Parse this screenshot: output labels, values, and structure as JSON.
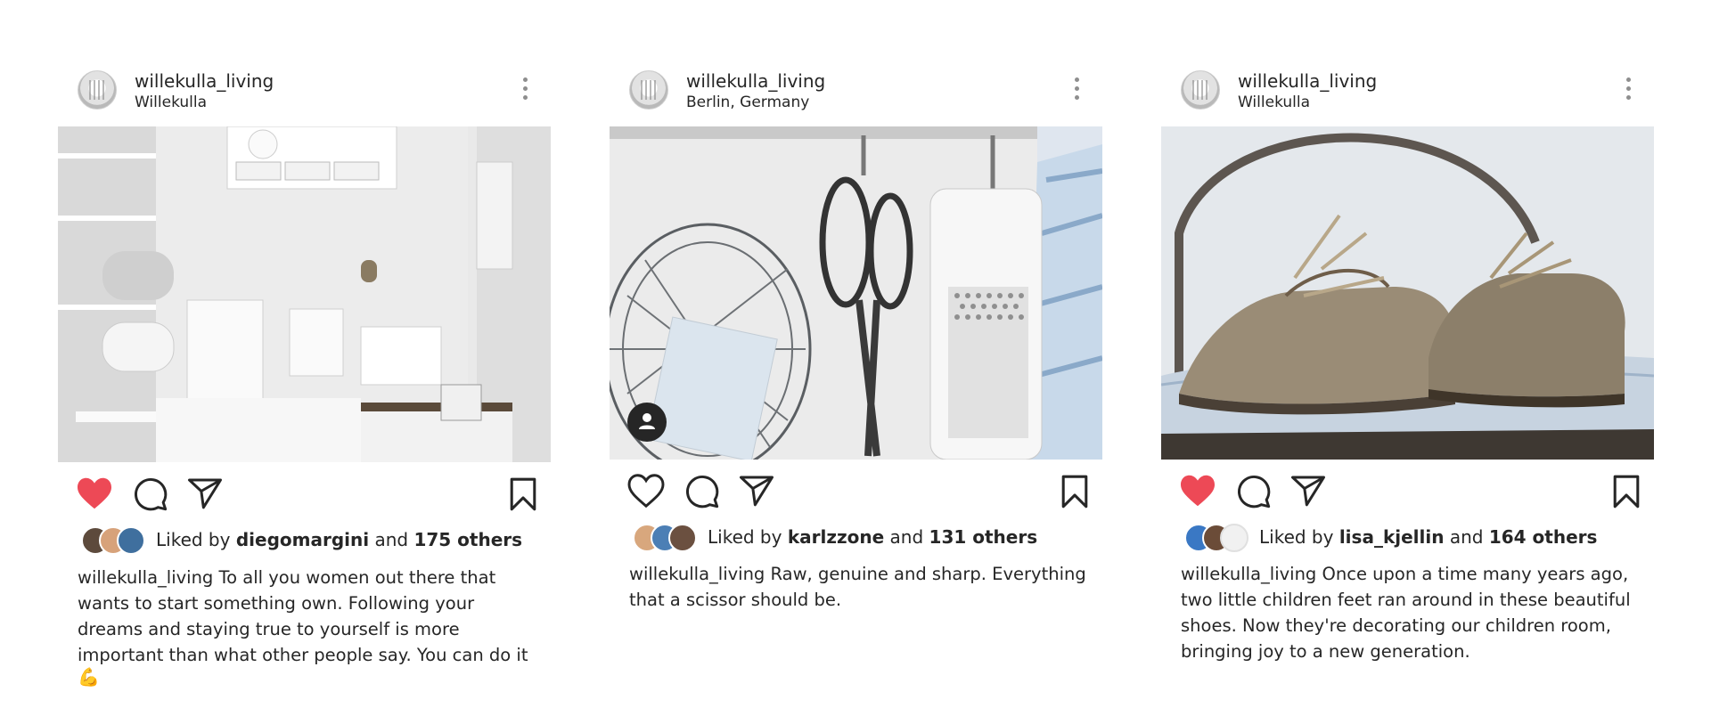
{
  "posts": [
    {
      "username": "willekulla_living",
      "location": "Willekulla",
      "liked_state": "liked",
      "liked_by_prefix": "Liked by",
      "liked_by_user": "diegomargini",
      "and_word": "and",
      "others": "175 others",
      "caption_user": "willekulla_living",
      "caption_text": "To all you women out there that wants to start something own. Following your dreams and staying true to yourself is more important than what other people say. You can do it",
      "caption_emoji": "💪"
    },
    {
      "username": "willekulla_living",
      "location": "Berlin, Germany",
      "liked_state": "not-liked",
      "liked_by_prefix": "Liked by",
      "liked_by_user": "karlzzone",
      "and_word": "and",
      "others": "131 others",
      "caption_user": "willekulla_living",
      "caption_text": "Raw, genuine and sharp. Everything that a scissor should be."
    },
    {
      "username": "willekulla_living",
      "location": "Willekulla",
      "liked_state": "liked",
      "liked_by_prefix": "Liked by",
      "liked_by_user": "lisa_kjellin",
      "and_word": "and",
      "others": "164 others",
      "caption_user": "willekulla_living",
      "caption_text": "Once upon a time many years ago, two little children feet ran around in these beautiful shoes. Now they're decorating our children room, bringing joy to a new generation."
    }
  ],
  "icons": {
    "like": "heart-icon",
    "comment": "comment-icon",
    "share": "paper-plane-icon",
    "save": "bookmark-icon",
    "more": "more-options-icon",
    "tag": "user-tag-icon"
  },
  "colors": {
    "like_red": "#ed4956",
    "text": "#262626",
    "icon_gray": "#8e8e8e"
  }
}
